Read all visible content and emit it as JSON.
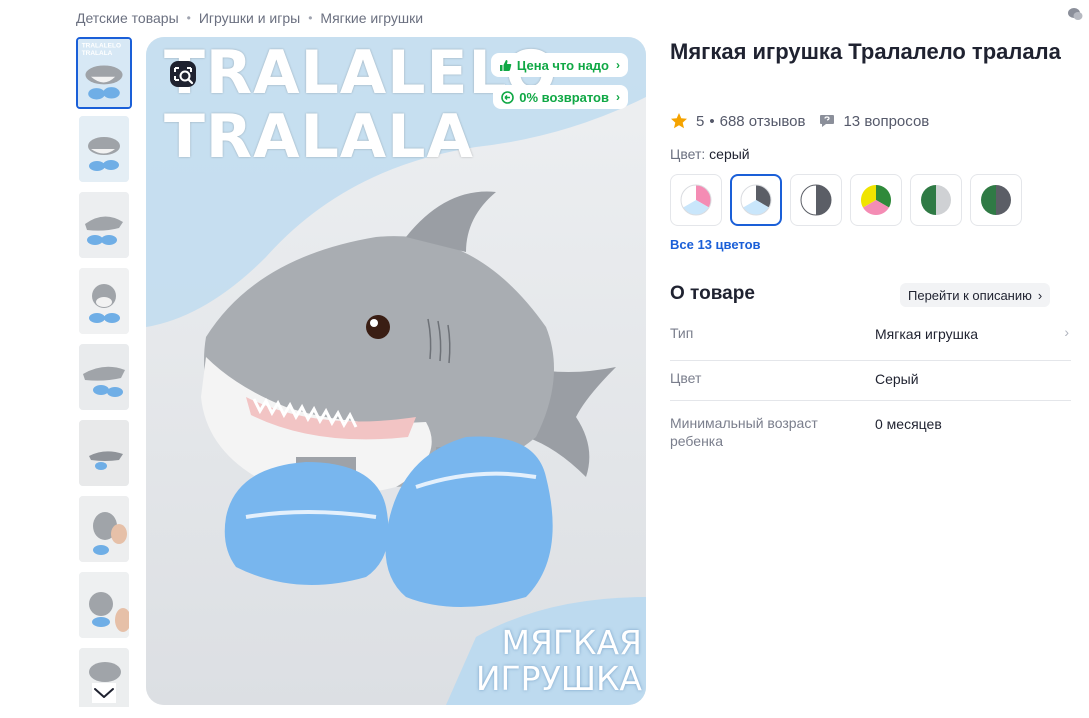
{
  "breadcrumb": [
    {
      "label": "Детские товары"
    },
    {
      "label": "Игрушки и игры"
    },
    {
      "label": "Мягкие игрушки"
    }
  ],
  "gallery": {
    "overlay_title_line1": "TRALALELO",
    "overlay_title_line2": "TRALALA",
    "overlay_subtitle_line1": "МЯГКАЯ",
    "overlay_subtitle_line2": "ИГРУШКА",
    "thumb_active_text_line1": "TRALALELO",
    "thumb_active_text_line2": "TRALALA",
    "thumbnail_count": 9,
    "promos": [
      {
        "label": "Цена что надо",
        "icon": "thumbs-up-icon"
      },
      {
        "label": "0% возвратов",
        "icon": "return-icon"
      }
    ],
    "search_by_photo_icon": "search-by-photo-icon"
  },
  "product": {
    "title": "Мягкая игрушка Тралалело тралала",
    "rating": "5",
    "reviews_link": "688 отзывов",
    "questions_link": "13 вопросов",
    "rating_separator": "•"
  },
  "colors": {
    "label": "Цвет:",
    "selected": "серый",
    "all_link": "Все 13 цветов",
    "swatches": [
      {
        "name": "pink-lightblue",
        "a": "#f48cb4",
        "b": "#c9e6fb",
        "c": "#ffffff"
      },
      {
        "name": "gray-lightblue",
        "a": "#5b5e66",
        "b": "#c9e6fb",
        "c": "#ffffff"
      },
      {
        "name": "gray-white",
        "a": "#5b5e66",
        "b": "#ffffff",
        "c": "#ffffff"
      },
      {
        "name": "yellow-green-pink",
        "a": "#2f8a3a",
        "b": "#f48cb4",
        "c": "#f0e400"
      },
      {
        "name": "green-lightgray",
        "a": "#2f7a45",
        "b": "#cfd1d4",
        "c": "#cfd1d4"
      },
      {
        "name": "green-gray",
        "a": "#2f7a45",
        "b": "#5b5e66",
        "c": "#5b5e66"
      }
    ]
  },
  "about": {
    "title": "О товаре",
    "goto_label": "Перейти к описанию",
    "rows": [
      {
        "key": "Тип",
        "value": "Мягкая игрушка"
      },
      {
        "key": "Цвет",
        "value": "Серый"
      },
      {
        "key": "Минимальный возраст ребенка",
        "value": "0 месяцев"
      }
    ]
  }
}
